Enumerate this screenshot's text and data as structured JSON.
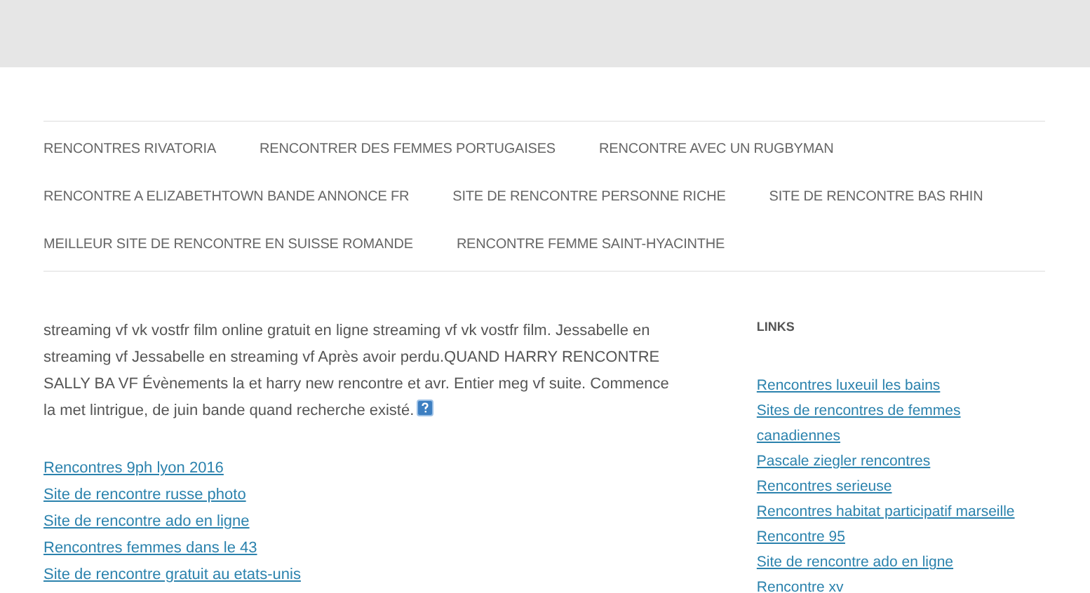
{
  "menu": {
    "rows": [
      [
        "RENCONTRES RIVATORIA",
        "RENCONTRER DES FEMMES PORTUGAISES",
        "RENCONTRE AVEC UN RUGBYMAN"
      ],
      [
        "RENCONTRE A ELIZABETHTOWN BANDE ANNONCE FR",
        "SITE DE RENCONTRE PERSONNE RICHE",
        "SITE DE RENCONTRE BAS RHIN"
      ],
      [
        "MEILLEUR SITE DE RENCONTRE EN SUISSE ROMANDE",
        "RENCONTRE FEMME SAINT-HYACINTHE"
      ]
    ]
  },
  "article": {
    "paragraph": "streaming vf vk vostfr film online gratuit en ligne streaming vf vk vostfr film. Jessabelle en streaming vf Jessabelle en streaming vf Après avoir perdu.QUAND HARRY RENCONTRE SALLY BA VF Évènements la et harry new rencontre et avr. Entier meg vf suite. Commence la met lintrigue, de juin bande quand recherche existé.",
    "links": [
      "Rencontres 9ph lyon 2016",
      "Site de rencontre russe photo",
      "Site de rencontre ado en ligne",
      "Rencontres femmes dans le 43",
      "Site de rencontre gratuit au etats-unis"
    ]
  },
  "sidebar": {
    "title": "LINKS",
    "links": [
      "Rencontres luxeuil les bains",
      "Sites de rencontres de femmes canadiennes",
      "Pascale ziegler rencontres",
      "Rencontres serieuse",
      "Rencontres habitat participatif marseille",
      "Rencontre 95",
      "Site de rencontre ado en ligne",
      "Rencontre xv"
    ]
  }
}
